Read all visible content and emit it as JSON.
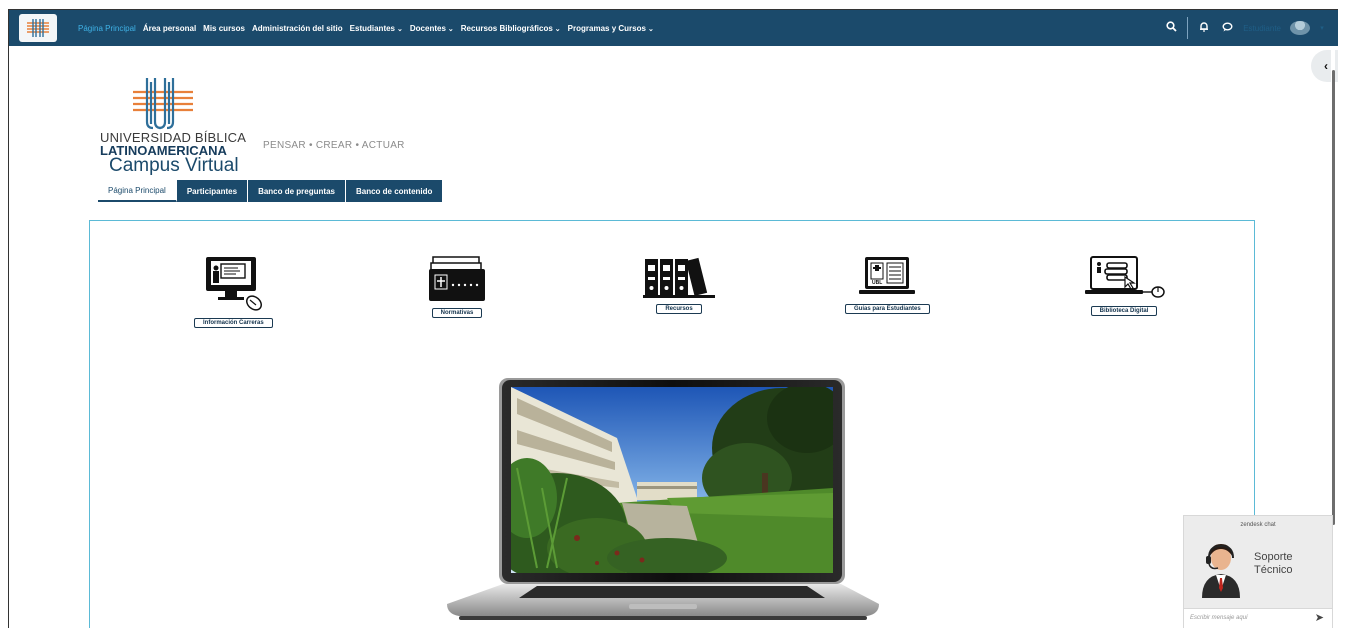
{
  "navbar": {
    "links": [
      {
        "label": "Página Principal",
        "active": true,
        "dropdown": false
      },
      {
        "label": "Área personal",
        "active": false,
        "dropdown": false
      },
      {
        "label": "Mis cursos",
        "active": false,
        "dropdown": false
      },
      {
        "label": "Administración del sitio",
        "active": false,
        "dropdown": false
      },
      {
        "label": "Estudiantes",
        "active": false,
        "dropdown": true
      },
      {
        "label": "Docentes",
        "active": false,
        "dropdown": true
      },
      {
        "label": "Recursos Bibliográficos",
        "active": false,
        "dropdown": true
      },
      {
        "label": "Programas y Cursos",
        "active": false,
        "dropdown": true
      }
    ],
    "right": {
      "search_icon": "search-icon",
      "notification_icon": "bell-icon",
      "messages_icon": "chat-bubble-icon",
      "user_name": "Estudiante"
    }
  },
  "header": {
    "university_line1": "UNIVERSIDAD BÍBLICA",
    "university_line2": "LATINOAMERICANA",
    "motto": "PENSAR • CREAR • ACTUAR",
    "site_title": "Campus Virtual"
  },
  "tabs": [
    {
      "label": "Página Principal",
      "active": true
    },
    {
      "label": "Participantes",
      "active": false
    },
    {
      "label": "Banco de preguntas",
      "active": false
    },
    {
      "label": "Banco de contenido",
      "active": false
    }
  ],
  "quick_links": [
    {
      "label": "Información Carreras",
      "icon": "presentation-monitor-icon"
    },
    {
      "label": "Normativas",
      "icon": "document-tray-icon"
    },
    {
      "label": "Recursos",
      "icon": "binders-icon"
    },
    {
      "label": "Guías para Estudiantes",
      "icon": "laptop-guide-icon"
    },
    {
      "label": "Biblioteca Digital",
      "icon": "digital-library-icon"
    }
  ],
  "chat_widget": {
    "header": "zendesk chat",
    "title_line1": "Soporte",
    "title_line2": "Técnico",
    "input_placeholder": "Escribir mensaje aquí"
  },
  "colors": {
    "navbar": "#1b4a6b",
    "active_link": "#3fb2e6",
    "content_border": "#5bbad6"
  }
}
